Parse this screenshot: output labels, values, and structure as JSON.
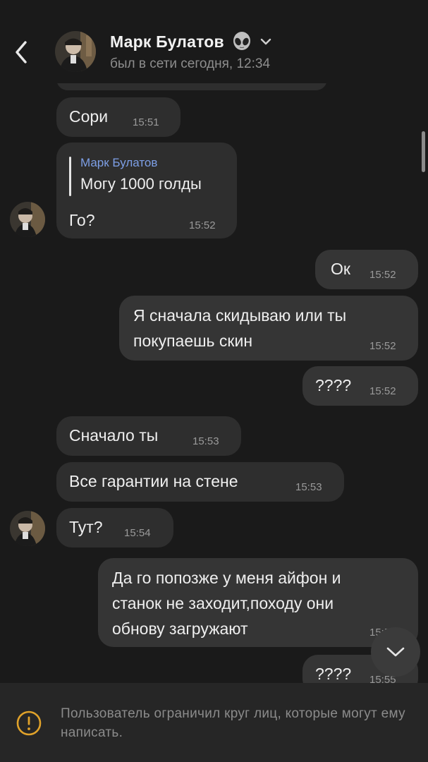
{
  "header": {
    "contact_name": "Марк Булатов",
    "status": "был в сети сегодня, 12:34"
  },
  "messages": [
    {
      "text": "Сори",
      "time": "15:51",
      "direction": "in"
    },
    {
      "reply_author": "Марк Булатов",
      "reply_text": "Могу 1000 голды",
      "text": "Го?",
      "time": "15:52",
      "direction": "in"
    },
    {
      "text": "Ок",
      "time": "15:52",
      "direction": "out"
    },
    {
      "lines": [
        "Я сначала скидываю или ты",
        "покупаешь скин"
      ],
      "time": "15:52",
      "direction": "out"
    },
    {
      "text": "????",
      "time": "15:52",
      "direction": "out"
    },
    {
      "text": "Сначало ты",
      "time": "15:53",
      "direction": "in"
    },
    {
      "text": "Все гарантии на стене",
      "time": "15:53",
      "direction": "in"
    },
    {
      "text": "Тут?",
      "time": "15:54",
      "direction": "in"
    },
    {
      "lines": [
        "Да го попозже у меня айфон и",
        "станок не заходит,походу они",
        "обнову загружают"
      ],
      "time": "15:55",
      "direction": "out"
    },
    {
      "text": "????",
      "time": "15:55",
      "direction": "out"
    }
  ],
  "footer": {
    "notice": "Пользователь ограничил круг лиц, которые могут ему написать."
  },
  "colors": {
    "background": "#1a1a1a",
    "incoming_bubble": "#2e2e2e",
    "outgoing_bubble": "#353535",
    "reply_author": "#7d9fe6",
    "warning": "#e0a22a"
  },
  "icons": [
    "back-arrow-icon",
    "alien-emoji-icon",
    "chevron-down-icon",
    "scroll-down-icon",
    "warning-icon"
  ]
}
